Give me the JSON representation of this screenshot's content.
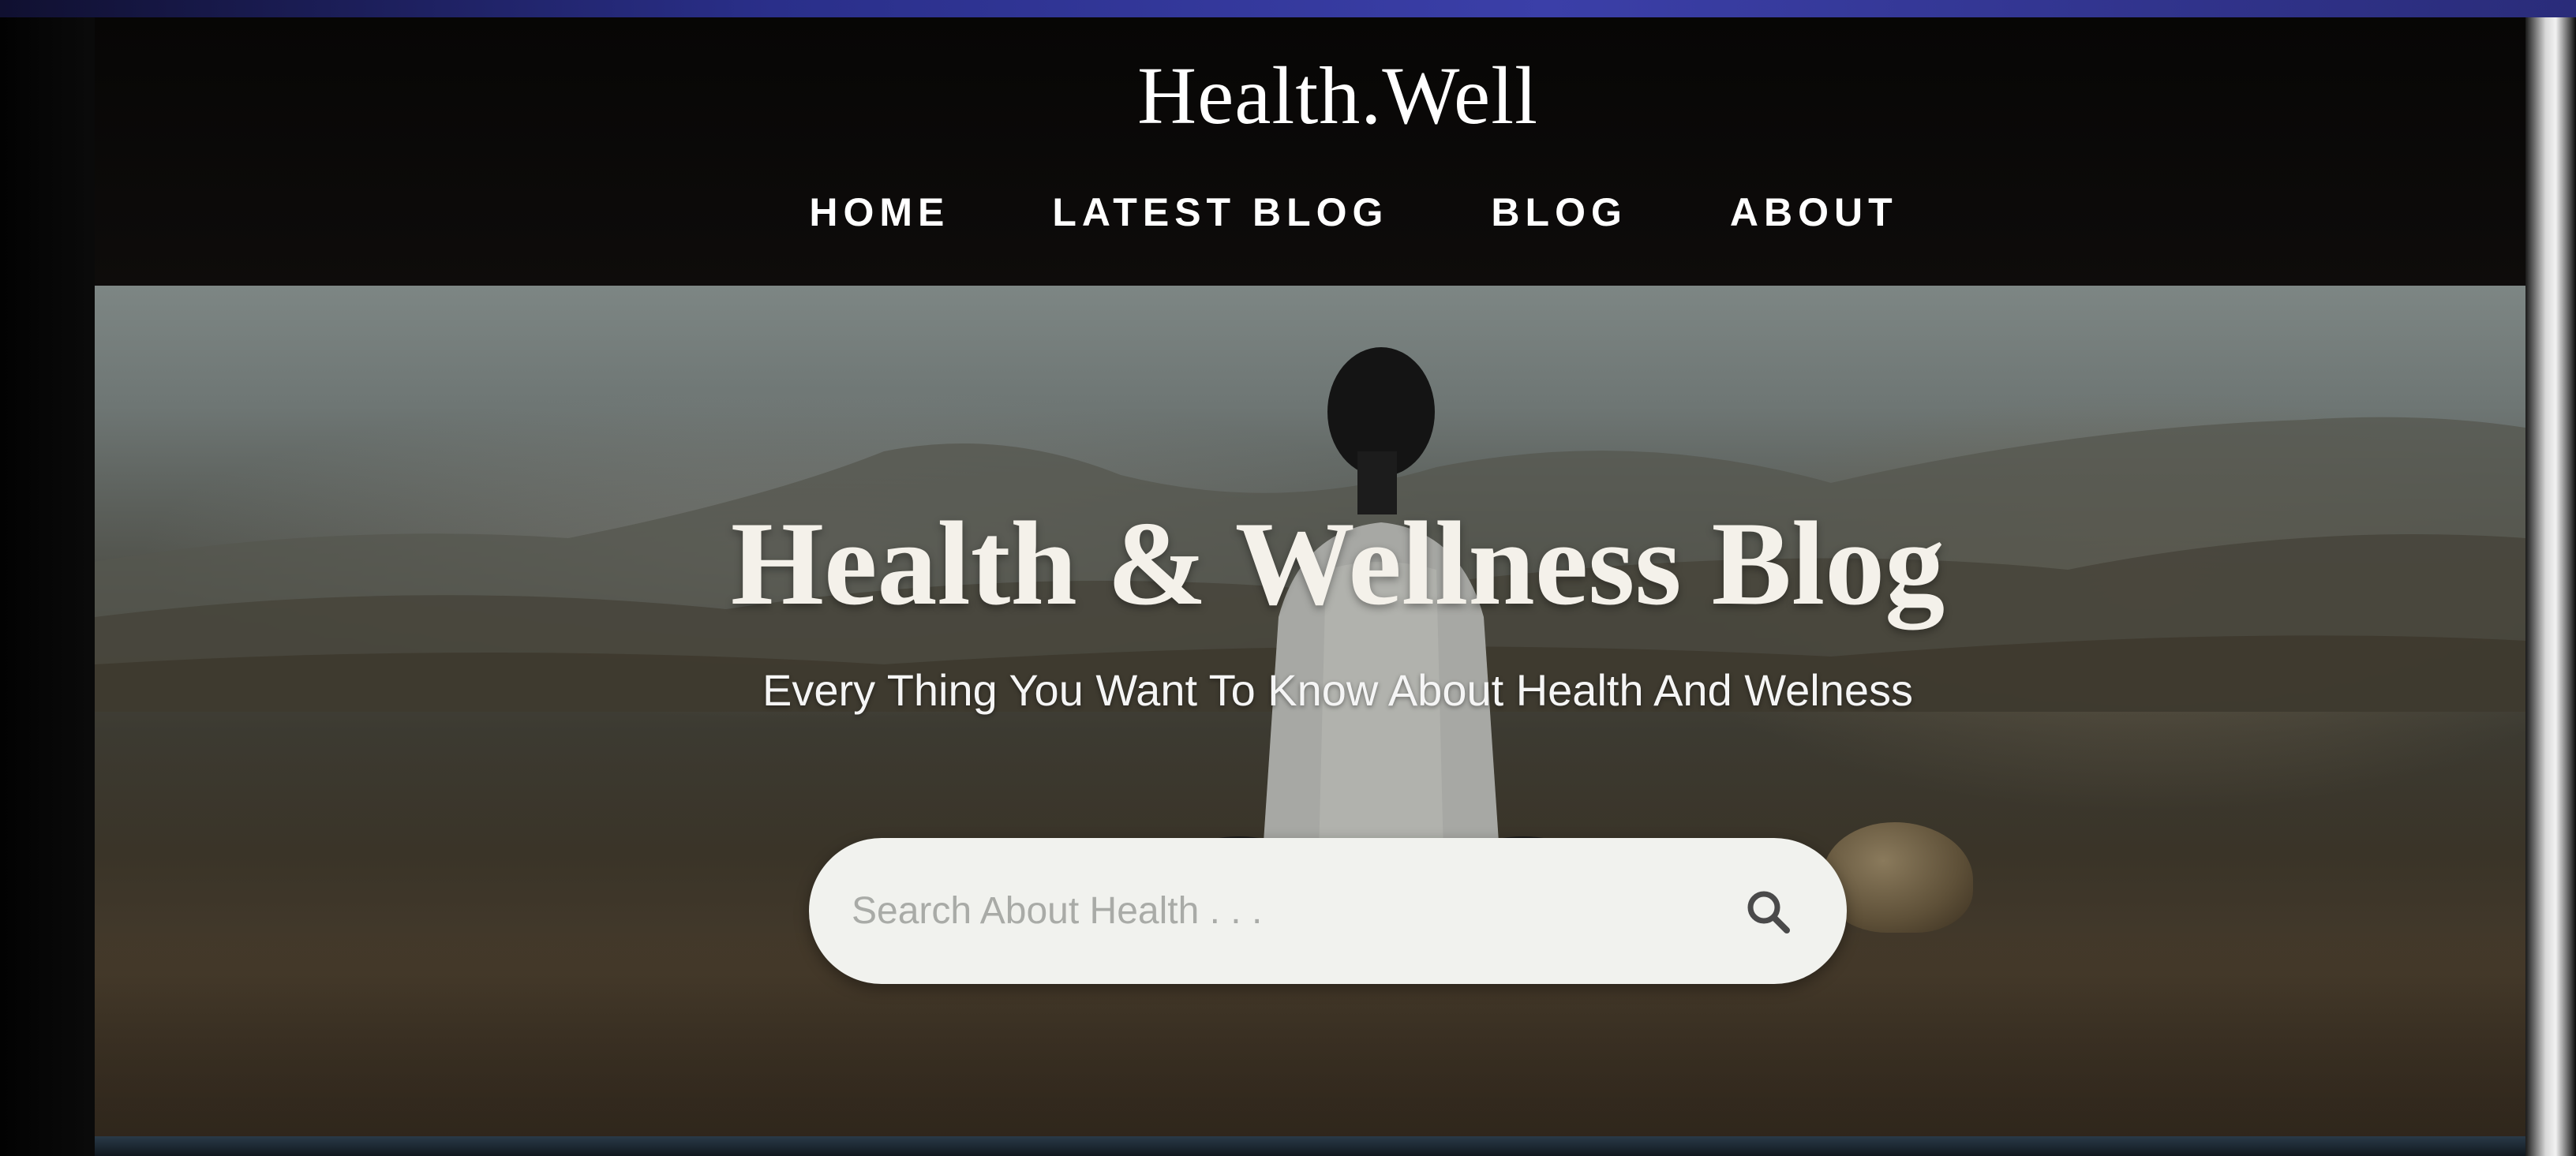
{
  "header": {
    "logo": "Health.Well",
    "nav": [
      {
        "label": "HOME"
      },
      {
        "label": "LATEST BLOG"
      },
      {
        "label": "BLOG"
      },
      {
        "label": "ABOUT"
      }
    ]
  },
  "hero": {
    "title": "Health & Wellness Blog",
    "subtitle": "Every Thing You Want To Know About Health And Welness",
    "search": {
      "placeholder": "Search About Health . . .",
      "button_icon": "search-icon"
    }
  },
  "colors": {
    "header_bg": "#0a0908",
    "text": "#ffffff",
    "search_bg": "#f1f2ee",
    "placeholder": "#a9aba7",
    "icon": "#4a4a4a"
  }
}
